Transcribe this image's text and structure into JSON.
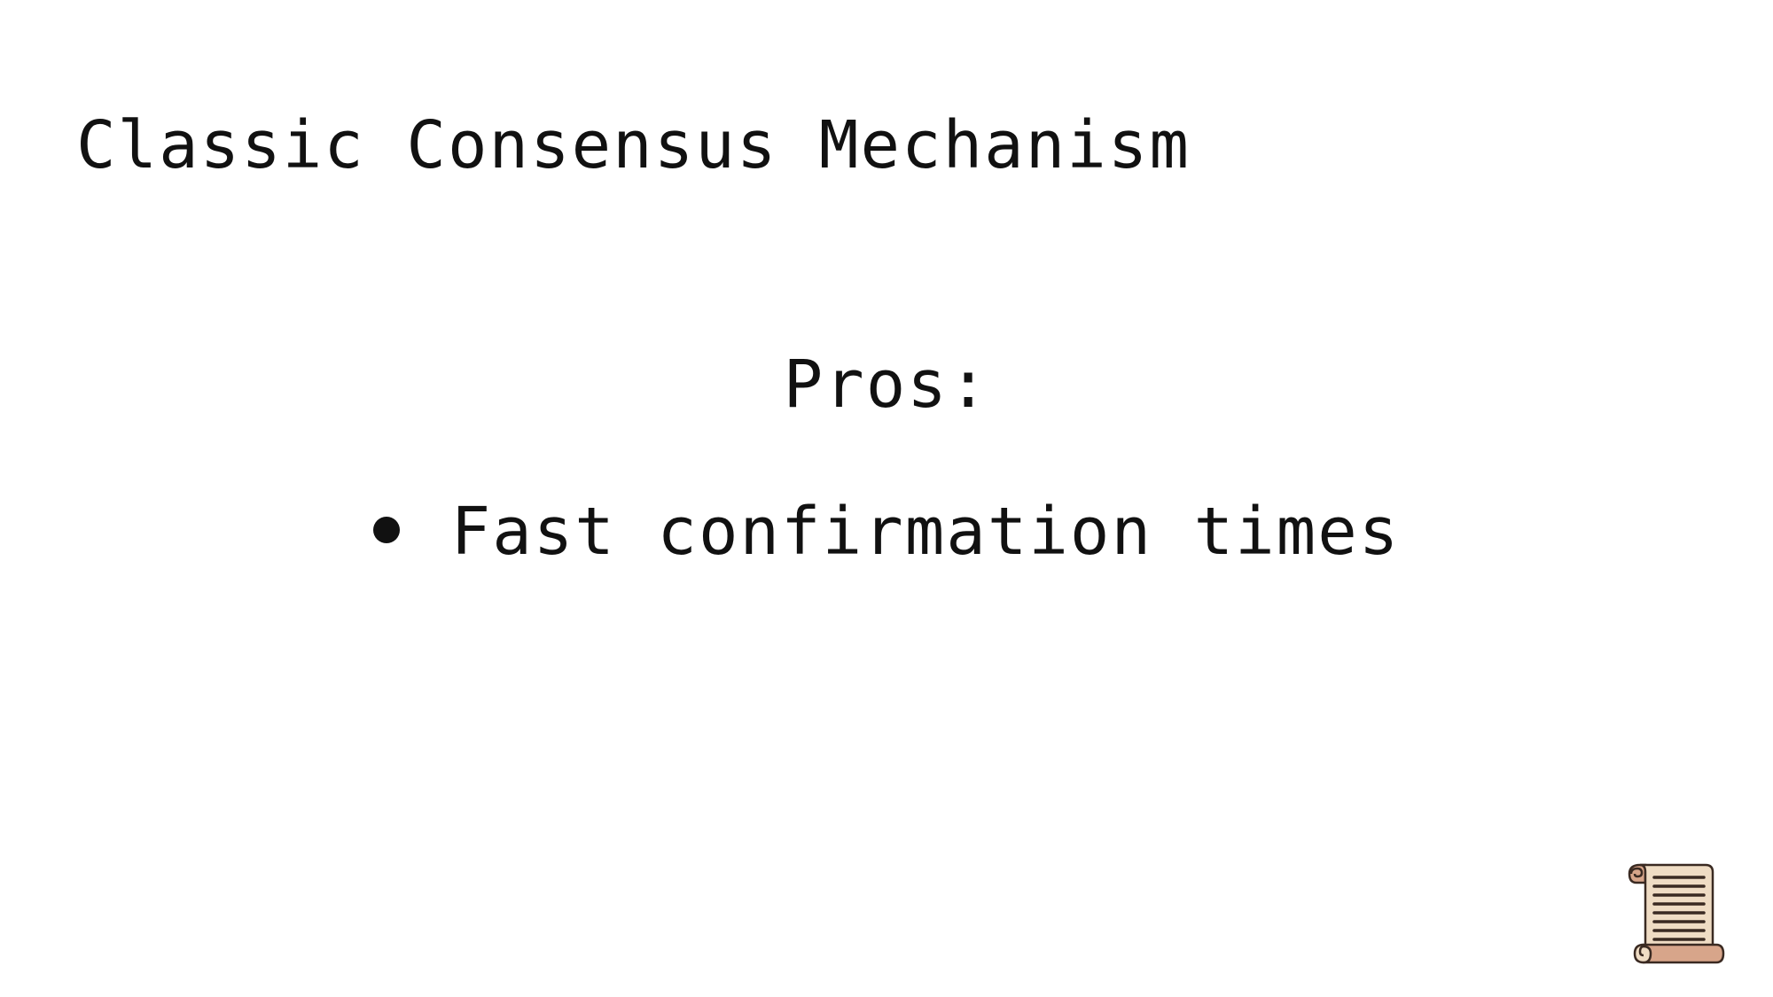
{
  "slide": {
    "title": "Classic Consensus Mechanism",
    "subheading": "Pros:",
    "bullets": [
      "Fast confirmation times"
    ],
    "corner_icon": "scroll-icon"
  }
}
